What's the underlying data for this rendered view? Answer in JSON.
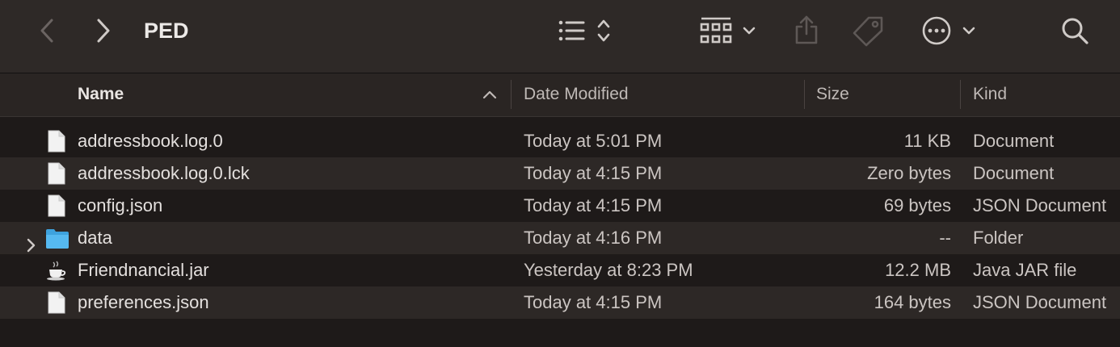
{
  "window": {
    "title": "PED"
  },
  "toolbar": {
    "back_icon": "chevron-left-icon",
    "forward_icon": "chevron-right-icon",
    "view_icon": "list-view-icon",
    "group_icon": "grid-group-icon",
    "share_icon": "share-icon",
    "tag_icon": "tag-icon",
    "more_icon": "ellipsis-circle-icon",
    "search_icon": "search-icon"
  },
  "columns": {
    "name": "Name",
    "date": "Date Modified",
    "size": "Size",
    "kind": "Kind"
  },
  "files": [
    {
      "name": "addressbook.log.0",
      "date": "Today at 5:01 PM",
      "size": "11 KB",
      "kind": "Document",
      "icon": "document-icon"
    },
    {
      "name": "addressbook.log.0.lck",
      "date": "Today at 4:15 PM",
      "size": "Zero bytes",
      "kind": "Document",
      "icon": "document-icon"
    },
    {
      "name": "config.json",
      "date": "Today at 4:15 PM",
      "size": "69 bytes",
      "kind": "JSON Document",
      "icon": "document-icon"
    },
    {
      "name": "data",
      "date": "Today at 4:16 PM",
      "size": "--",
      "kind": "Folder",
      "icon": "folder-icon"
    },
    {
      "name": "Friendnancial.jar",
      "date": "Yesterday at 8:23 PM",
      "size": "12.2 MB",
      "kind": "Java JAR file",
      "icon": "java-jar-icon"
    },
    {
      "name": "preferences.json",
      "date": "Today at 4:15 PM",
      "size": "164 bytes",
      "kind": "JSON Document",
      "icon": "document-icon"
    }
  ],
  "colors": {
    "toolbar_bg": "#2e2927",
    "list_bg": "#1e1a19",
    "alt_row_bg": "#2d2826",
    "folder_blue": "#4fb3ee"
  }
}
